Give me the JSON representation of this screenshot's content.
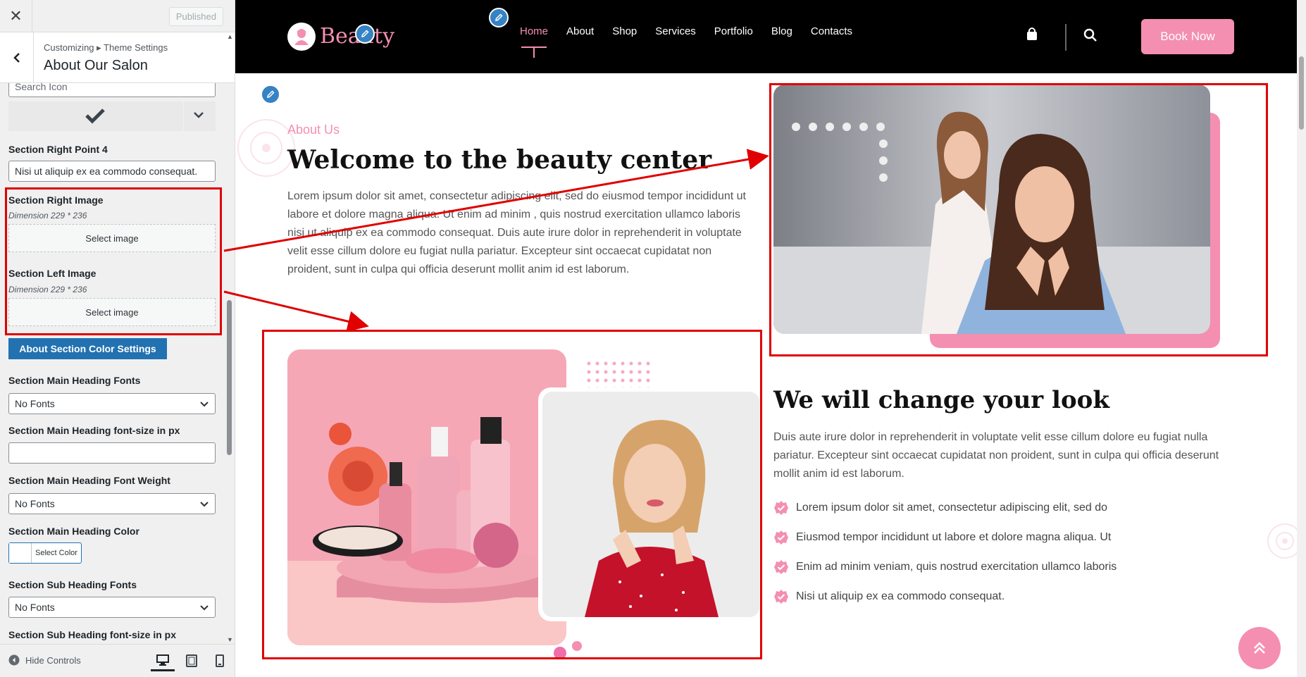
{
  "sidebar": {
    "published_label": "Published",
    "breadcrumb": "Customizing ▸ Theme Settings",
    "title": "About Our Salon",
    "search_icon_placeholder": "Search Icon",
    "right_point_4_label": "Section Right Point 4",
    "right_point_4_value": "Nisi ut aliquip ex ea commodo consequat.",
    "right_image_label": "Section Right Image",
    "right_image_dimension": "Dimension 229 * 236",
    "right_image_button": "Select image",
    "left_image_label": "Section Left Image",
    "left_image_dimension": "Dimension 229 * 236",
    "left_image_button": "Select image",
    "color_settings_button": "About Section Color Settings",
    "main_heading_fonts_label": "Section Main Heading Fonts",
    "main_heading_fonts_value": "No Fonts",
    "main_heading_size_label": "Section Main Heading font-size in px",
    "main_heading_size_value": "",
    "main_heading_weight_label": "Section Main Heading Font Weight",
    "main_heading_weight_value": "No Fonts",
    "main_heading_color_label": "Section Main Heading Color",
    "select_color_label": "Select Color",
    "sub_heading_fonts_label": "Section Sub Heading Fonts",
    "sub_heading_fonts_value": "No Fonts",
    "sub_heading_size_label": "Section Sub Heading font-size in px",
    "hide_controls_label": "Hide Controls"
  },
  "site": {
    "logo_text": "Beauty",
    "nav": [
      "Home",
      "About",
      "Shop",
      "Services",
      "Portfolio",
      "Blog",
      "Contacts"
    ],
    "book_now": "Book Now",
    "about_label": "About Us",
    "about_heading": "Welcome to the beauty center",
    "about_paragraph": "Lorem ipsum dolor sit amet, consectetur adipiscing elit, sed do eiusmod tempor incididunt ut labore et dolore magna aliqua. Ut enim ad minim , quis nostrud exercitation ullamco laboris nisi ut aliquip ex ea commodo consequat. Duis aute irure dolor in reprehenderit in voluptate velit esse cillum dolore eu fugiat nulla pariatur. Excepteur sint occaecat cupidatat non proident, sunt in culpa qui officia deserunt mollit anim id est laborum.",
    "change_heading": "We will change your look",
    "change_paragraph": "Duis aute irure dolor in reprehenderit in voluptate velit esse cillum dolore eu fugiat nulla pariatur. Excepteur sint occaecat cupidatat non proident, sunt in culpa qui officia deserunt mollit anim id est laborum.",
    "points": [
      "Lorem ipsum dolor sit amet, consectetur adipiscing elit, sed do",
      "Eiusmod tempor incididunt ut labore et dolore magna aliqua. Ut",
      "Enim ad minim veniam, quis nostrud exercitation ullamco laboris",
      "Nisi ut aliquip ex ea commodo consequat."
    ]
  },
  "colors": {
    "accent_pink": "#f48fb1",
    "header_black": "#000000",
    "annotation_red": "#e00000",
    "wp_blue": "#2271b1"
  }
}
